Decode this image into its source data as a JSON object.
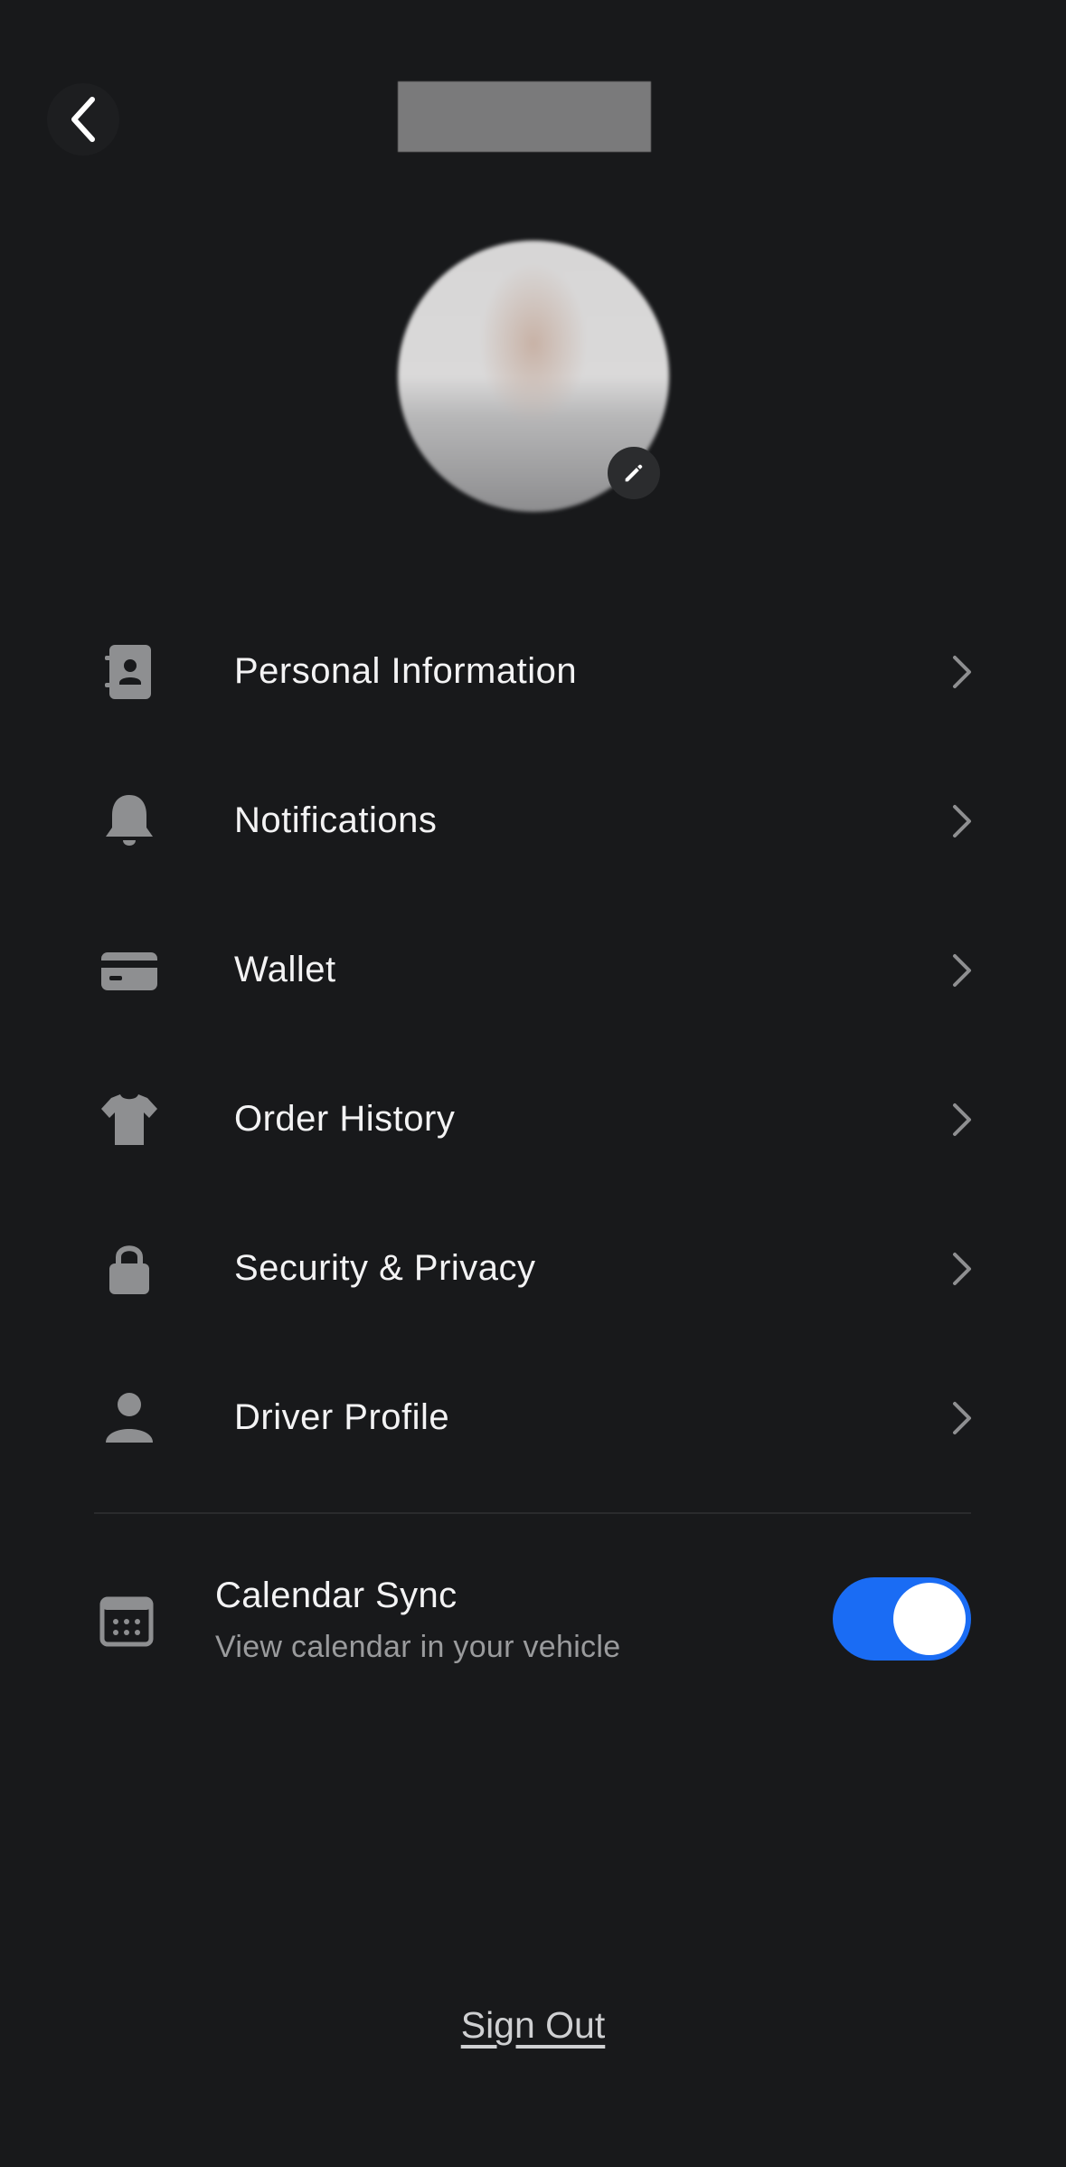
{
  "header": {
    "title": "",
    "back_icon": "chevron-left-icon"
  },
  "profile": {
    "avatar": "avatar",
    "edit_icon": "pencil-icon"
  },
  "menu": {
    "items": [
      {
        "label": "Personal Information",
        "icon": "contact-card-icon"
      },
      {
        "label": "Notifications",
        "icon": "bell-icon"
      },
      {
        "label": "Wallet",
        "icon": "credit-card-icon"
      },
      {
        "label": "Order History",
        "icon": "tshirt-icon"
      },
      {
        "label": "Security & Privacy",
        "icon": "lock-icon"
      },
      {
        "label": "Driver Profile",
        "icon": "person-icon"
      }
    ]
  },
  "calendar_sync": {
    "title": "Calendar Sync",
    "subtitle": "View calendar in your vehicle",
    "enabled": true,
    "icon": "calendar-icon"
  },
  "footer": {
    "sign_out_label": "Sign Out"
  },
  "colors": {
    "background": "#18191b",
    "text": "#f3f3f4",
    "muted_text": "#9a9b9d",
    "icon": "#8e8f91",
    "accent": "#1a6cf4"
  }
}
